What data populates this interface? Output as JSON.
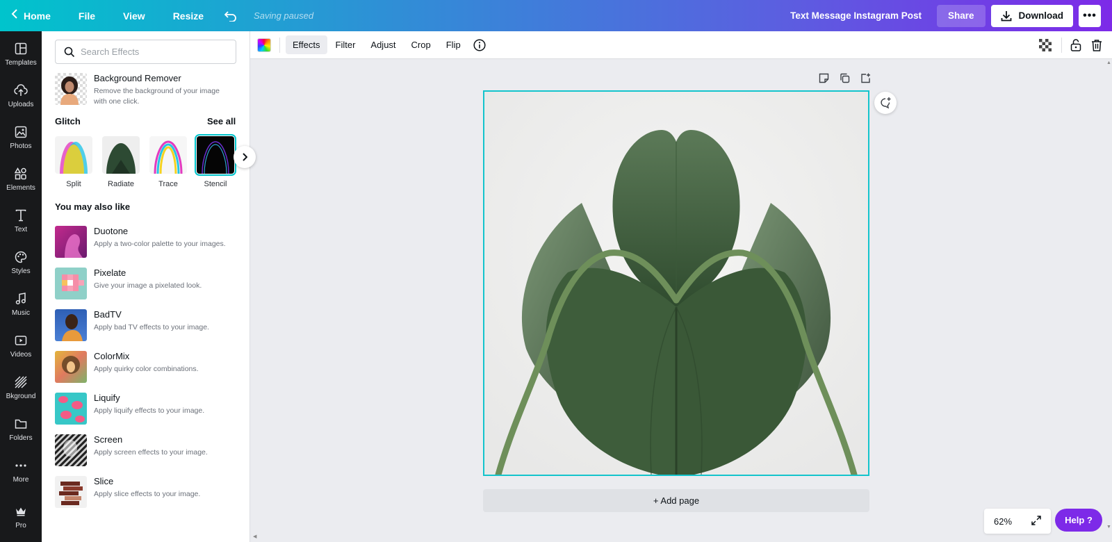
{
  "topbar": {
    "home": "Home",
    "file": "File",
    "view": "View",
    "resize": "Resize",
    "saving_status": "Saving paused",
    "design_title": "Text Message Instagram Post",
    "share": "Share",
    "download": "Download",
    "more": "•••"
  },
  "rail": [
    {
      "label": "Templates",
      "icon": "templates-icon"
    },
    {
      "label": "Uploads",
      "icon": "uploads-icon"
    },
    {
      "label": "Photos",
      "icon": "photos-icon"
    },
    {
      "label": "Elements",
      "icon": "elements-icon"
    },
    {
      "label": "Text",
      "icon": "text-icon"
    },
    {
      "label": "Styles",
      "icon": "styles-icon"
    },
    {
      "label": "Music",
      "icon": "music-icon"
    },
    {
      "label": "Videos",
      "icon": "videos-icon"
    },
    {
      "label": "Bkground",
      "icon": "background-icon"
    },
    {
      "label": "Folders",
      "icon": "folders-icon"
    },
    {
      "label": "More",
      "icon": "more-icon"
    },
    {
      "label": "Pro",
      "icon": "crown-icon"
    }
  ],
  "panel": {
    "search_placeholder": "Search Effects",
    "background_remover": {
      "name": "Background Remover",
      "desc_line1": "Remove the background of your image",
      "desc_line2": "with one click."
    },
    "glitch": {
      "title": "Glitch",
      "see_all": "See all",
      "items": [
        "Split",
        "Radiate",
        "Trace",
        "Stencil"
      ]
    },
    "also_like_title": "You may also like",
    "effects": [
      {
        "name": "Duotone",
        "desc": "Apply a two-color palette to your images."
      },
      {
        "name": "Pixelate",
        "desc": "Give your image a pixelated look."
      },
      {
        "name": "BadTV",
        "desc": "Apply bad TV effects to your image."
      },
      {
        "name": "ColorMix",
        "desc": "Apply quirky color combinations."
      },
      {
        "name": "Liquify",
        "desc": "Apply liquify effects to your image."
      },
      {
        "name": "Screen",
        "desc": "Apply screen effects to your image."
      },
      {
        "name": "Slice",
        "desc": "Apply slice effects to your image."
      }
    ]
  },
  "toolbar": {
    "effects": "Effects",
    "filter": "Filter",
    "adjust": "Adjust",
    "crop": "Crop",
    "flip": "Flip"
  },
  "canvas": {
    "add_page": "+ Add page"
  },
  "footer": {
    "zoom": "62%",
    "help": "Help ?"
  },
  "colors": {
    "accent": "#00c4cc",
    "purple": "#7d2ae8",
    "rail_bg": "#18191b"
  }
}
